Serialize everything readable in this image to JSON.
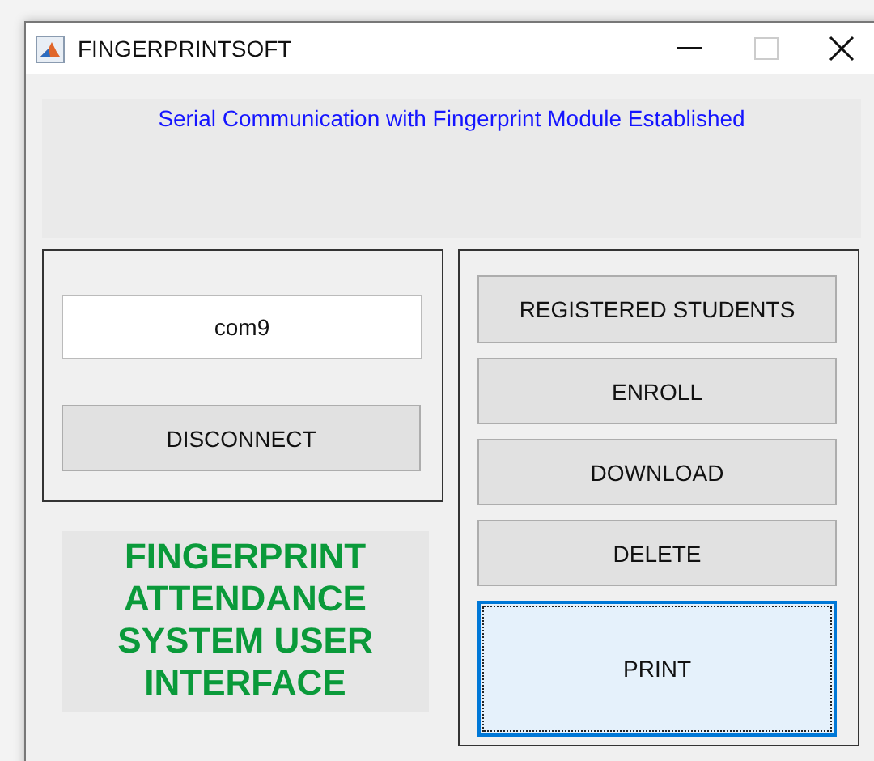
{
  "window": {
    "title": "FINGERPRINTSOFT"
  },
  "status": "Serial Communication with Fingerprint Module Established",
  "port_field": {
    "value": "com9"
  },
  "connect_button": "DISCONNECT",
  "app_title": "FINGERPRINT ATTENDANCE SYSTEM USER INTERFACE",
  "buttons": [
    {
      "label": "REGISTERED STUDENTS",
      "focused": false
    },
    {
      "label": "ENROLL",
      "focused": false
    },
    {
      "label": "DOWNLOAD",
      "focused": false
    },
    {
      "label": "DELETE",
      "focused": false
    },
    {
      "label": "PRINT",
      "focused": true
    }
  ]
}
